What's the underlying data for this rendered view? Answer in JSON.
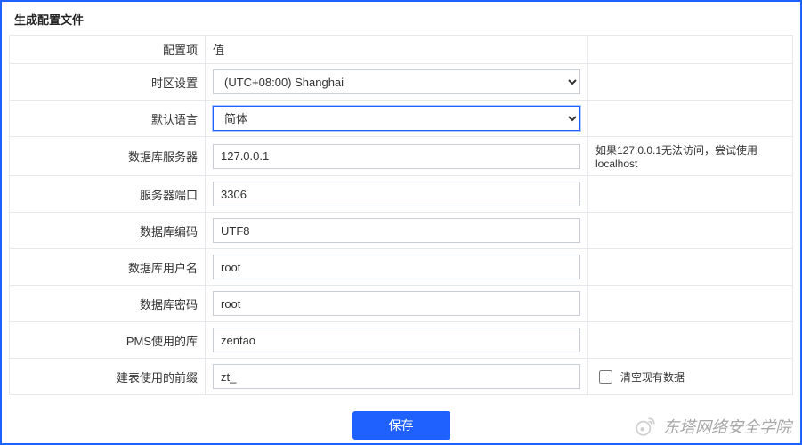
{
  "panel": {
    "title": "生成配置文件"
  },
  "table": {
    "header": {
      "col1": "配置项",
      "col2": "值"
    },
    "rows": {
      "timezone": {
        "label": "时区设置",
        "value": "(UTC+08:00) Shanghai"
      },
      "language": {
        "label": "默认语言",
        "value": "简体"
      },
      "db_host": {
        "label": "数据库服务器",
        "value": "127.0.0.1",
        "hint": "如果127.0.0.1无法访问，尝试使用localhost"
      },
      "db_port": {
        "label": "服务器端口",
        "value": "3306"
      },
      "db_encoding": {
        "label": "数据库编码",
        "value": "UTF8"
      },
      "db_user": {
        "label": "数据库用户名",
        "value": "root"
      },
      "db_password": {
        "label": "数据库密码",
        "value": "root"
      },
      "pms_db": {
        "label": "PMS使用的库",
        "value": "zentao"
      },
      "table_prefix": {
        "label": "建表使用的前缀",
        "value": "zt_",
        "clear_label": "清空现有数据",
        "clear_checked": false
      }
    }
  },
  "actions": {
    "submit": "保存"
  },
  "watermark": {
    "text": "东塔网络安全学院"
  }
}
